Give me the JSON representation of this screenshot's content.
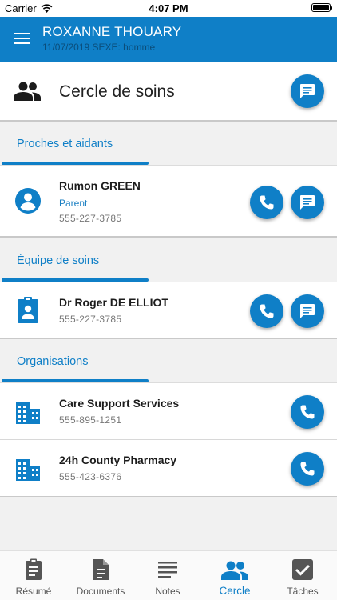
{
  "status_bar": {
    "carrier": "Carrier",
    "time": "4:07 PM"
  },
  "app_header": {
    "patient_name": "ROXANNE THOUARY",
    "patient_info": "11/07/2019 SEXE: homme"
  },
  "page": {
    "title": "Cercle de soins"
  },
  "sections": [
    {
      "title": "Proches et aidants",
      "contacts": [
        {
          "name": "Rumon GREEN",
          "role": "Parent",
          "phone": "555-227-3785"
        }
      ]
    },
    {
      "title": "Équipe de soins",
      "contacts": [
        {
          "name": "Dr Roger DE ELLIOT",
          "phone": "555-227-3785"
        }
      ]
    },
    {
      "title": "Organisations",
      "contacts": [
        {
          "name": "Care Support Services",
          "phone": "555-895-1251"
        },
        {
          "name": "24h County Pharmacy",
          "phone": "555-423-6376"
        }
      ]
    }
  ],
  "bottom_nav": {
    "items": [
      {
        "label": "Résumé",
        "icon": "clipboard-icon"
      },
      {
        "label": "Documents",
        "icon": "document-icon"
      },
      {
        "label": "Notes",
        "icon": "notes-icon"
      },
      {
        "label": "Cercle",
        "icon": "people-icon",
        "active": true
      },
      {
        "label": "Tâches",
        "icon": "checkbox-icon"
      }
    ]
  },
  "colors": {
    "primary": "#0f7fc7",
    "background": "#f1f1f1",
    "secondary_text": "#777777"
  }
}
